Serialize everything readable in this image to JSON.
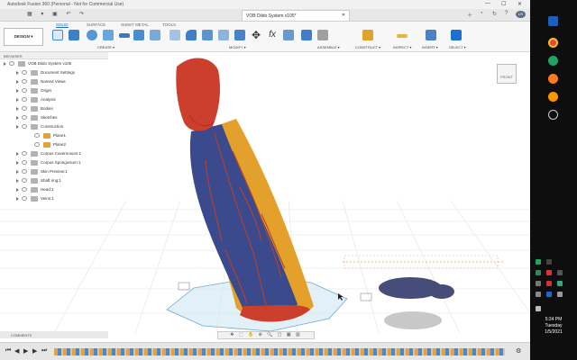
{
  "window": {
    "app_title": "Autodesk Fusion 360 (Personal - Not for Commercial Use)",
    "doc_tab": "VOB Dildo System v105*",
    "minimize": "—",
    "maximize": "☐",
    "close": "✕"
  },
  "ribbon": {
    "design_button": "DESIGN ▾",
    "tabs": [
      "SOLID",
      "SURFACE",
      "SHEET METAL",
      "TOOLS"
    ],
    "groups": [
      "CREATE ▾",
      "MODIFY ▾",
      "ASSEMBLE ▾",
      "CONSTRUCT ▾",
      "INSPECT ▾",
      "INSERT ▾",
      "SELECT ▾"
    ]
  },
  "browser": {
    "title": "BROWSER",
    "items": [
      {
        "label": "VOB Dildo System v105",
        "level": 0
      },
      {
        "label": "Document Settings",
        "level": 1
      },
      {
        "label": "Named Views",
        "level": 1
      },
      {
        "label": "Origin",
        "level": 1
      },
      {
        "label": "Analysis",
        "level": 1
      },
      {
        "label": "Bodies",
        "level": 1
      },
      {
        "label": "Sketches",
        "level": 1
      },
      {
        "label": "Construction",
        "level": 1
      },
      {
        "label": "Plane1",
        "level": 2
      },
      {
        "label": "Plane2",
        "level": 2
      },
      {
        "label": "Corpus Cavernosum:1",
        "level": 1
      },
      {
        "label": "Corpus Spongiosum:1",
        "level": 1
      },
      {
        "label": "Skin Preview:1",
        "level": 1
      },
      {
        "label": "Shaft ring:1",
        "level": 1
      },
      {
        "label": "Head:1",
        "level": 1
      },
      {
        "label": "Veins:1",
        "level": 1
      }
    ]
  },
  "viewcube": {
    "face": "FRONT"
  },
  "comments": {
    "label": "COMMENTS"
  },
  "taskbar": {
    "time": "5:24 PM",
    "day": "Tuesday",
    "date": "1/5/2021"
  },
  "colors": {
    "head": "#cc3f2c",
    "shaft_blue": "#3b4a8c",
    "shaft_yellow": "#e3a02a",
    "vein": "#b8402e",
    "plane_fill": "#cfe6f4",
    "plane_stroke": "#6aaad6"
  }
}
